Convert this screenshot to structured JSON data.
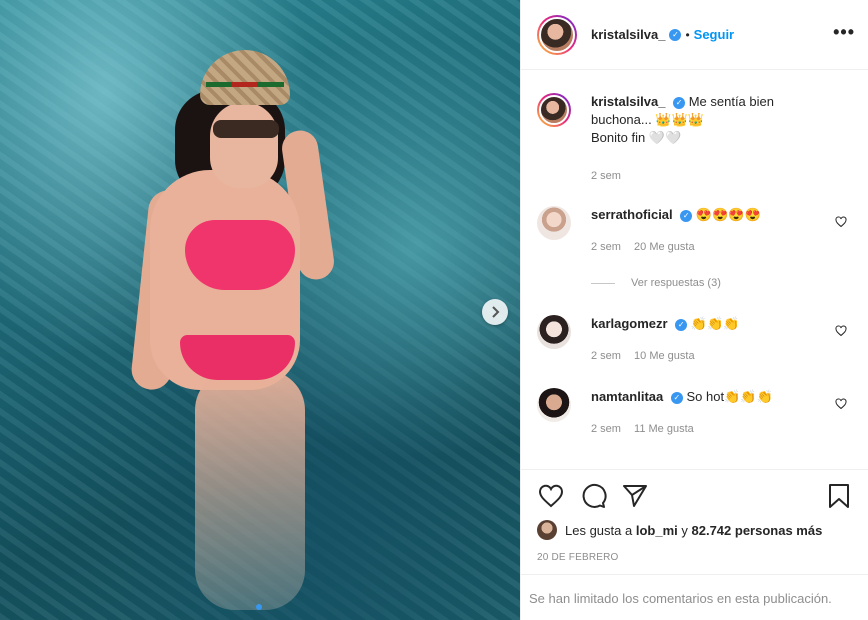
{
  "post": {
    "username": "kristalsilva_",
    "follow_label": "Seguir",
    "separator": "•",
    "more_label": "•••"
  },
  "caption": {
    "username": "kristalsilva_",
    "line1": "Me sentía bien",
    "line2": "buchona... 👑👑👑",
    "line3": "Bonito fin 🤍🤍",
    "time": "2 sem"
  },
  "comments": [
    {
      "username": "serrathoficial",
      "text": "😍😍😍😍",
      "time": "2 sem",
      "likes": "20 Me gusta"
    },
    {
      "username": "karlagomezr",
      "text": "👏👏👏",
      "time": "2 sem",
      "likes": "10 Me gusta"
    },
    {
      "username": "namtanlitaa",
      "text": "So hot👏👏👏",
      "time": "2 sem",
      "likes": "11 Me gusta"
    }
  ],
  "replies_label": "Ver respuestas (3)",
  "likes": {
    "prefix": "Les gusta a ",
    "user": "lob_mi",
    "mid": " y ",
    "count": "82.742 personas más"
  },
  "date": "20 DE FEBRERO",
  "limited_notice": "Se han limitado los comentarios en esta publicación.",
  "icons": [
    "heart-icon",
    "comment-icon",
    "share-icon",
    "bookmark-icon",
    "chevron-right-icon",
    "verified-icon",
    "more-icon"
  ],
  "colors": {
    "accent": "#0095f6",
    "verified": "#3897f0",
    "muted": "#8e8e8e",
    "bikini": "#f0356d",
    "water": "#1f6d7c"
  }
}
